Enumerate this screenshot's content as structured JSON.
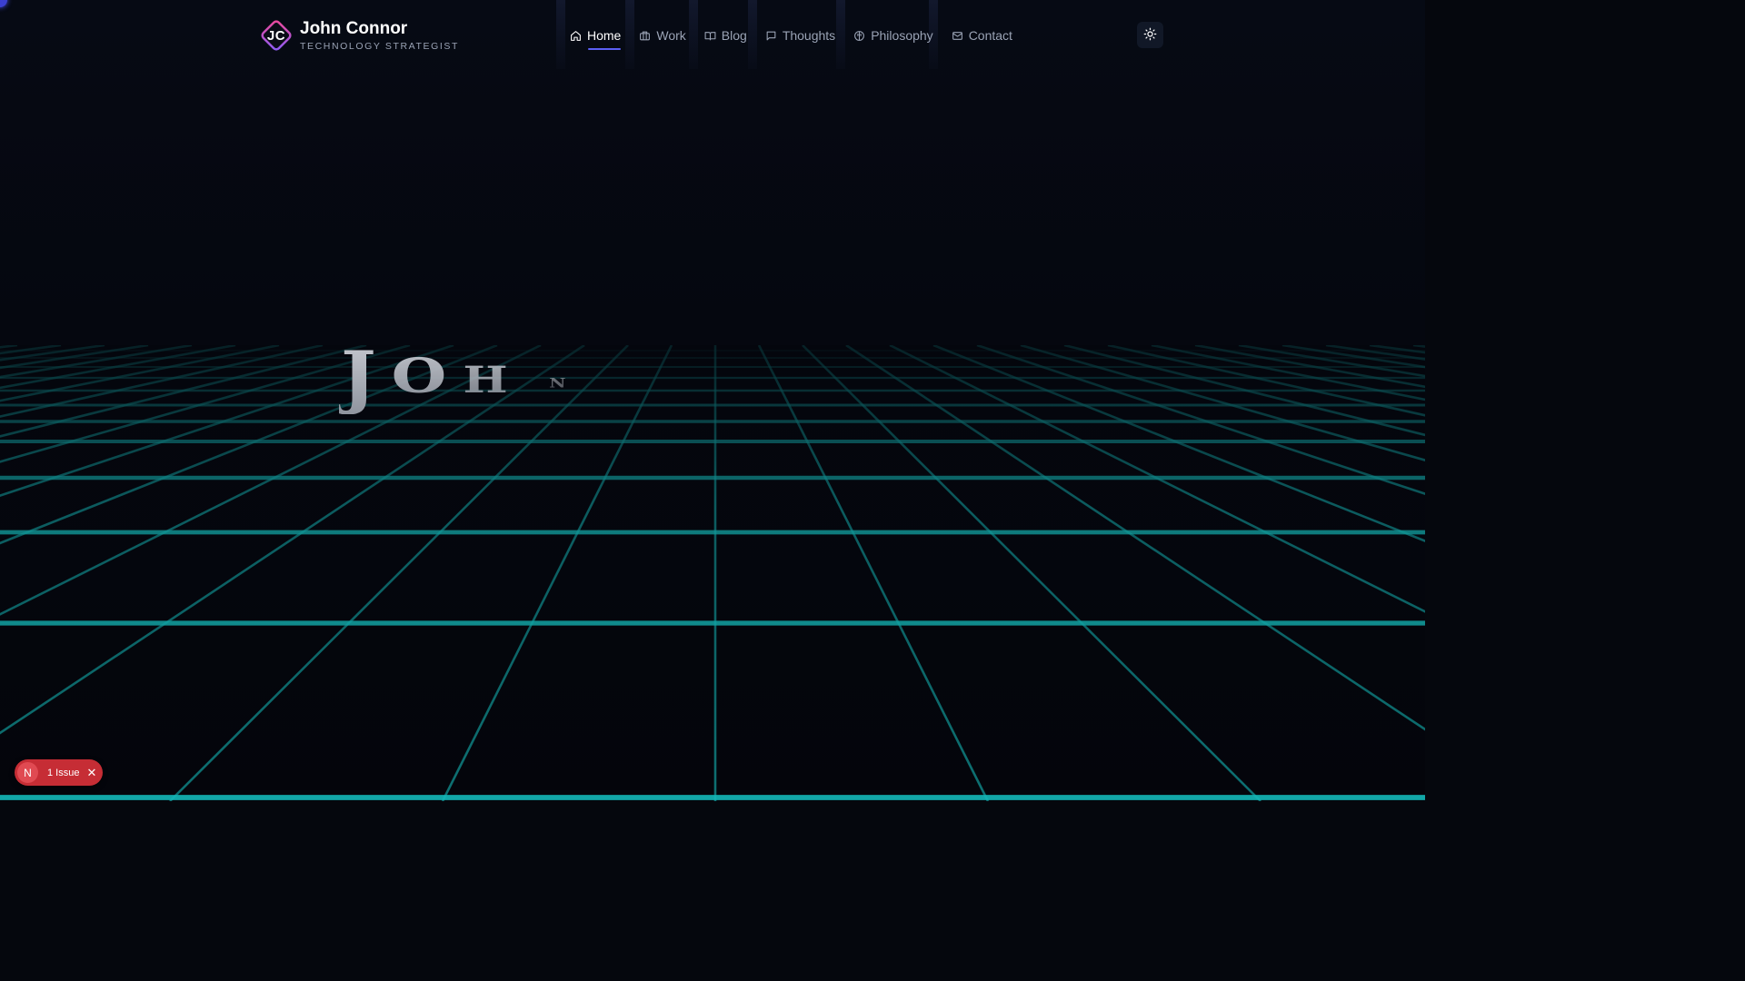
{
  "header": {
    "logo_initials": "JC",
    "name": "John Connor",
    "role": "TECHNOLOGY STRATEGIST",
    "nav": [
      {
        "label": "Home",
        "icon": "home-icon",
        "active": true
      },
      {
        "label": "Work",
        "icon": "briefcase-icon",
        "active": false
      },
      {
        "label": "Blog",
        "icon": "book-icon",
        "active": false
      },
      {
        "label": "Thoughts",
        "icon": "chat-bubble-icon",
        "active": false
      },
      {
        "label": "Philosophy",
        "icon": "brain-icon",
        "active": false
      },
      {
        "label": "Contact",
        "icon": "mail-icon",
        "active": false
      }
    ],
    "theme_toggle_icon": "sun-icon"
  },
  "hero": {
    "name_text": "JOHN"
  },
  "issue_badge": {
    "logo": "N",
    "label": "1 Issue",
    "close": "✕"
  },
  "colors": {
    "accent": "#5b5ff5",
    "grid": "#14b8b8",
    "logo_gradient_start": "#ec4899",
    "logo_gradient_end": "#8b5cf6",
    "issue_badge": "#c62d35"
  }
}
